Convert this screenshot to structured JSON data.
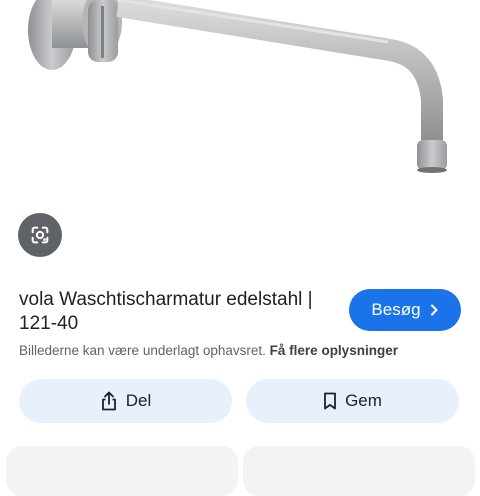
{
  "result": {
    "title": "vola Waschtischarmatur edelstahl | 121-40",
    "visit_label": "Besøg",
    "notice_text": "Billederne kan være underlagt ophavsret.",
    "notice_link": "Få flere oplysninger"
  },
  "actions": {
    "share_label": "Del",
    "save_label": "Gem"
  },
  "icons": {
    "lens": "google-lens-icon",
    "visit_chevron": "chevron-right-icon",
    "share": "share-icon",
    "save": "bookmark-icon"
  },
  "colors": {
    "accent": "#1a73e8",
    "action_bg": "#e8f0fe",
    "lens_bg": "#5f6368"
  }
}
